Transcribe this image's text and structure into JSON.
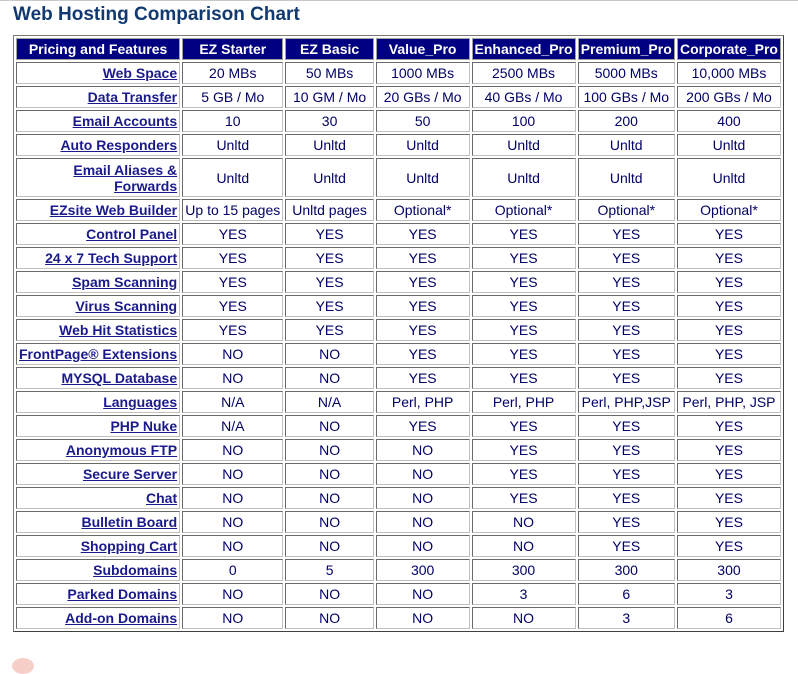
{
  "title": "Web Hosting Comparison Chart",
  "table": {
    "headers": [
      "Pricing and Features",
      "EZ Starter",
      "EZ Basic",
      "Value_Pro",
      "Enhanced_Pro",
      "Premium_Pro",
      "Corporate_Pro"
    ],
    "rows": [
      {
        "feature": "Web Space",
        "values": [
          "20 MBs",
          "50 MBs",
          "1000 MBs",
          "2500 MBs",
          "5000 MBs",
          "10,000 MBs"
        ]
      },
      {
        "feature": "Data Transfer",
        "values": [
          "5 GB / Mo",
          "10 GM / Mo",
          "20 GBs / Mo",
          "40 GBs / Mo",
          "100 GBs / Mo",
          "200 GBs / Mo"
        ]
      },
      {
        "feature": "Email Accounts",
        "values": [
          "10",
          "30",
          "50",
          "100",
          "200",
          "400"
        ]
      },
      {
        "feature": "Auto Responders",
        "values": [
          "Unltd",
          "Unltd",
          "Unltd",
          "Unltd",
          "Unltd",
          "Unltd"
        ]
      },
      {
        "feature": "Email Aliases & Forwards",
        "values": [
          "Unltd",
          "Unltd",
          "Unltd",
          "Unltd",
          "Unltd",
          "Unltd"
        ],
        "tall": true
      },
      {
        "feature": "EZsite Web Builder",
        "values": [
          "Up to 15 pages",
          "Unltd pages",
          "Optional*",
          "Optional*",
          "Optional*",
          "Optional*"
        ]
      },
      {
        "feature": "Control Panel",
        "values": [
          "YES",
          "YES",
          "YES",
          "YES",
          "YES",
          "YES"
        ]
      },
      {
        "feature": "24 x 7 Tech Support",
        "values": [
          "YES",
          "YES",
          "YES",
          "YES",
          "YES",
          "YES"
        ]
      },
      {
        "feature": "Spam Scanning",
        "values": [
          "YES",
          "YES",
          "YES",
          "YES",
          "YES",
          "YES"
        ]
      },
      {
        "feature": "Virus Scanning",
        "values": [
          "YES",
          "YES",
          "YES",
          "YES",
          "YES",
          "YES"
        ]
      },
      {
        "feature": "Web Hit Statistics",
        "values": [
          "YES",
          "YES",
          "YES",
          "YES",
          "YES",
          "YES"
        ]
      },
      {
        "feature": "FrontPage® Extensions",
        "values": [
          "NO",
          "NO",
          "YES",
          "YES",
          "YES",
          "YES"
        ]
      },
      {
        "feature": "MYSQL Database",
        "values": [
          "NO",
          "NO",
          "YES",
          "YES",
          "YES",
          "YES"
        ]
      },
      {
        "feature": "Languages",
        "values": [
          "N/A",
          "N/A",
          "Perl, PHP",
          "Perl, PHP",
          "Perl, PHP,JSP",
          "Perl, PHP, JSP"
        ]
      },
      {
        "feature": "PHP Nuke",
        "values": [
          "N/A",
          "NO",
          "YES",
          "YES",
          "YES",
          "YES"
        ]
      },
      {
        "feature": "Anonymous FTP",
        "values": [
          "NO",
          "NO",
          "NO",
          "YES",
          "YES",
          "YES"
        ]
      },
      {
        "feature": "Secure Server",
        "values": [
          "NO",
          "NO",
          "NO",
          "YES",
          "YES",
          "YES"
        ]
      },
      {
        "feature": "Chat",
        "values": [
          "NO",
          "NO",
          "NO",
          "YES",
          "YES",
          "YES"
        ]
      },
      {
        "feature": "Bulletin Board",
        "values": [
          "NO",
          "NO",
          "NO",
          "NO",
          "YES",
          "YES"
        ]
      },
      {
        "feature": "Shopping Cart",
        "values": [
          "NO",
          "NO",
          "NO",
          "NO",
          "YES",
          "YES"
        ]
      },
      {
        "feature": "Subdomains",
        "values": [
          "0",
          "5",
          "300",
          "300",
          "300",
          "300"
        ]
      },
      {
        "feature": "Parked Domains",
        "values": [
          "NO",
          "NO",
          "NO",
          "3",
          "6",
          "3"
        ]
      },
      {
        "feature": "Add-on Domains",
        "values": [
          "NO",
          "NO",
          "NO",
          "NO",
          "3",
          "6"
        ]
      }
    ]
  },
  "colors": {
    "header_bg": "#000080",
    "header_text": "#ffffff",
    "title": "#123a70",
    "link": "#1a1a8c",
    "cell_text": "#000066"
  }
}
